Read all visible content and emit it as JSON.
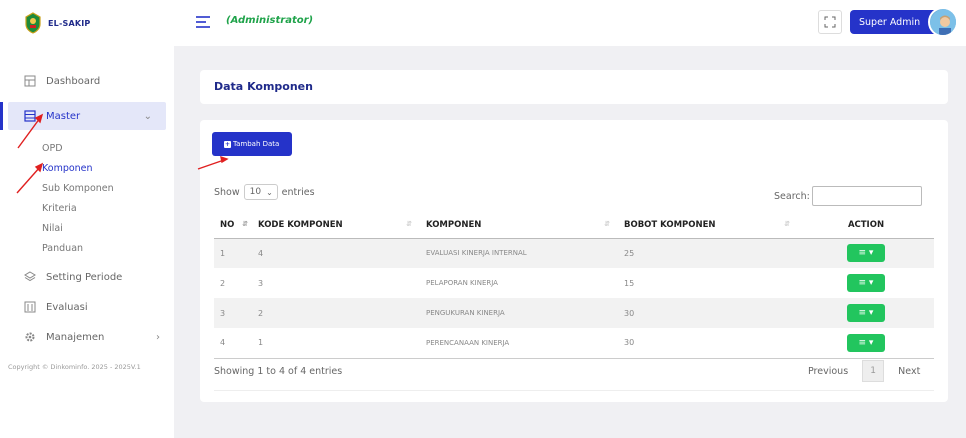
{
  "brand": {
    "name": "EL-SAKIP"
  },
  "header": {
    "role": "(Administrator)",
    "user_label": "Super Admin"
  },
  "sidebar": {
    "items": [
      {
        "label": "Dashboard",
        "icon": "dashboard-icon"
      },
      {
        "label": "Master",
        "icon": "master-icon",
        "expanded": true
      },
      {
        "label": "Setting Periode",
        "icon": "layers-icon"
      },
      {
        "label": "Evaluasi",
        "icon": "evaluasi-icon"
      },
      {
        "label": "Manajemen",
        "icon": "gear-icon"
      }
    ],
    "sub_items": [
      "OPD",
      "Komponen",
      "Sub Komponen",
      "Kriteria",
      "Nilai",
      "Panduan"
    ],
    "active_sub": "Komponen",
    "copyright": "Copyright © Dinkominfo. 2025 - 2025V.1"
  },
  "page": {
    "title": "Data Komponen"
  },
  "toolbar": {
    "add_label": "Tambah Data"
  },
  "table": {
    "show_label": "Show",
    "entries_value": "10",
    "entries_label": "entries",
    "search_label": "Search:",
    "columns": [
      "NO",
      "KODE KOMPONEN",
      "KOMPONEN",
      "BOBOT KOMPONEN",
      "ACTION"
    ],
    "rows": [
      {
        "no": "1",
        "kode": "4",
        "komponen": "EVALUASI KINERJA INTERNAL",
        "bobot": "25"
      },
      {
        "no": "2",
        "kode": "3",
        "komponen": "PELAPORAN KINERJA",
        "bobot": "15"
      },
      {
        "no": "3",
        "kode": "2",
        "komponen": "PENGUKURAN KINERJA",
        "bobot": "30"
      },
      {
        "no": "4",
        "kode": "1",
        "komponen": "PERENCANAAN KINERJA",
        "bobot": "30"
      }
    ],
    "info": "Showing 1 to 4 of 4 entries",
    "prev_label": "Previous",
    "page_number": "1",
    "next_label": "Next"
  },
  "colors": {
    "primary": "#2533c9",
    "success": "#22c55e",
    "role": "#1fa34a",
    "annotation": "#e02020"
  }
}
